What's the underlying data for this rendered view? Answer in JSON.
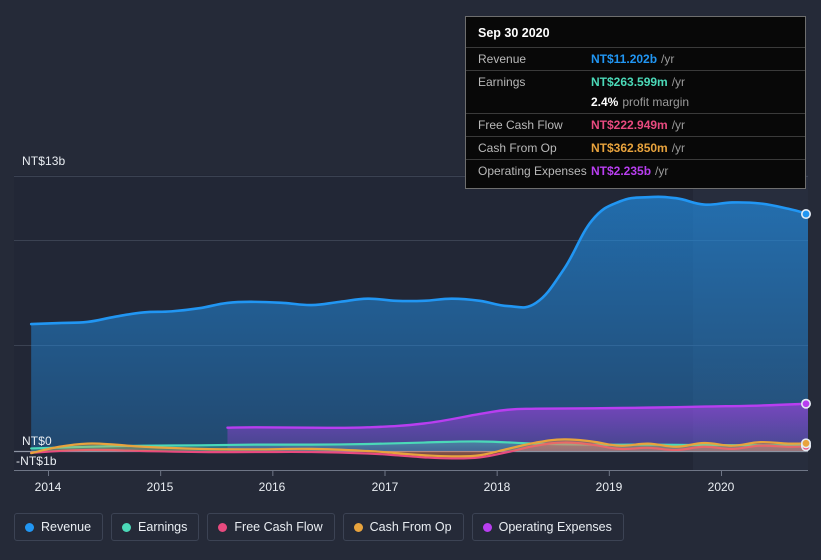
{
  "chart_data": {
    "type": "area",
    "title": "",
    "currency": "NT$",
    "xlabel": "",
    "ylabel": "",
    "ylim": [
      -1,
      13
    ],
    "y_ticks": [
      {
        "label": "NT$13b",
        "value": 13
      },
      {
        "label": "NT$0",
        "value": 0
      },
      {
        "label": "-NT$1b",
        "value": -1
      }
    ],
    "x_ticks": [
      "2014",
      "2015",
      "2016",
      "2017",
      "2018",
      "2019",
      "2020"
    ],
    "x_range": [
      "2013.8",
      "2020.9"
    ],
    "grid": true,
    "legend_position": "bottom-left",
    "series": [
      {
        "name": "Revenue",
        "color": "#2196f3",
        "x": [
          2013.85,
          2014.1,
          2014.35,
          2014.6,
          2014.85,
          2015.1,
          2015.35,
          2015.6,
          2015.85,
          2016.1,
          2016.35,
          2016.6,
          2016.85,
          2017.1,
          2017.35,
          2017.6,
          2017.85,
          2018.1,
          2018.35,
          2018.6,
          2018.85,
          2019.1,
          2019.35,
          2019.6,
          2019.85,
          2020.1,
          2020.35,
          2020.6,
          2020.78
        ],
        "values": [
          6.0,
          6.05,
          6.1,
          6.35,
          6.55,
          6.6,
          6.75,
          7.0,
          7.05,
          7.0,
          6.9,
          7.05,
          7.2,
          7.1,
          7.1,
          7.2,
          7.1,
          6.85,
          7.0,
          8.6,
          10.9,
          11.8,
          12.0,
          11.95,
          11.65,
          11.75,
          11.7,
          11.45,
          11.202
        ]
      },
      {
        "name": "Earnings",
        "color": "#4bd9b8",
        "x": [
          2013.85,
          2014.35,
          2014.85,
          2015.35,
          2015.85,
          2016.35,
          2016.85,
          2017.35,
          2017.85,
          2018.35,
          2018.85,
          2019.35,
          2019.85,
          2020.35,
          2020.78
        ],
        "values": [
          0.12,
          0.2,
          0.25,
          0.27,
          0.3,
          0.3,
          0.33,
          0.4,
          0.45,
          0.35,
          0.3,
          0.3,
          0.28,
          0.27,
          0.263599
        ]
      },
      {
        "name": "Free Cash Flow",
        "color": "#e84a7f",
        "x": [
          2013.85,
          2014.35,
          2014.85,
          2015.35,
          2015.85,
          2016.35,
          2016.85,
          2017.1,
          2017.35,
          2017.6,
          2017.85,
          2018.1,
          2018.35,
          2018.6,
          2018.85,
          2019.1,
          2019.35,
          2019.6,
          2019.85,
          2020.1,
          2020.35,
          2020.6,
          2020.78
        ],
        "values": [
          -0.08,
          0.05,
          0.0,
          -0.05,
          -0.05,
          -0.05,
          -0.12,
          -0.2,
          -0.3,
          -0.35,
          -0.3,
          -0.05,
          0.25,
          0.4,
          0.3,
          0.1,
          0.15,
          0.05,
          0.2,
          0.1,
          0.25,
          0.2,
          0.222949
        ]
      },
      {
        "name": "Cash From Op",
        "color": "#e8a33d",
        "x": [
          2013.85,
          2014.1,
          2014.35,
          2014.6,
          2014.85,
          2015.35,
          2015.85,
          2016.35,
          2016.85,
          2017.1,
          2017.35,
          2017.6,
          2017.85,
          2018.1,
          2018.35,
          2018.6,
          2018.85,
          2019.1,
          2019.35,
          2019.6,
          2019.85,
          2020.1,
          2020.35,
          2020.6,
          2020.78
        ],
        "values": [
          -0.1,
          0.2,
          0.35,
          0.3,
          0.2,
          0.1,
          0.08,
          0.1,
          0.0,
          -0.1,
          -0.2,
          -0.25,
          -0.2,
          0.1,
          0.4,
          0.55,
          0.45,
          0.25,
          0.35,
          0.2,
          0.38,
          0.25,
          0.42,
          0.35,
          0.36285
        ]
      },
      {
        "name": "Operating Expenses",
        "color": "#b83ef0",
        "x": [
          2015.6,
          2015.85,
          2016.35,
          2016.85,
          2017.35,
          2017.85,
          2018.1,
          2018.35,
          2018.85,
          2019.35,
          2019.85,
          2020.35,
          2020.78
        ],
        "values": [
          1.1,
          1.12,
          1.1,
          1.12,
          1.3,
          1.75,
          1.95,
          2.0,
          2.02,
          2.05,
          2.1,
          2.15,
          2.235
        ]
      }
    ]
  },
  "tooltip": {
    "date": "Sep 30 2020",
    "rows": [
      {
        "label": "Revenue",
        "value": "NT$11.202b",
        "unit": "/yr",
        "color": "#2196f3"
      },
      {
        "label": "Earnings",
        "value": "NT$263.599m",
        "unit": "/yr",
        "color": "#4bd9b8"
      },
      {
        "label": "",
        "value": "2.4%",
        "unit": "profit margin",
        "color": "#ffffff"
      },
      {
        "label": "Free Cash Flow",
        "value": "NT$222.949m",
        "unit": "/yr",
        "color": "#e84a7f"
      },
      {
        "label": "Cash From Op",
        "value": "NT$362.850m",
        "unit": "/yr",
        "color": "#e8a33d"
      },
      {
        "label": "Operating Expenses",
        "value": "NT$2.235b",
        "unit": "/yr",
        "color": "#b83ef0"
      }
    ]
  },
  "legend": {
    "items": [
      {
        "label": "Revenue",
        "color": "#2196f3"
      },
      {
        "label": "Earnings",
        "color": "#4bd9b8"
      },
      {
        "label": "Free Cash Flow",
        "color": "#e84a7f"
      },
      {
        "label": "Cash From Op",
        "color": "#e8a33d"
      },
      {
        "label": "Operating Expenses",
        "color": "#b83ef0"
      }
    ]
  },
  "axis": {
    "y_labels": [
      "NT$13b",
      "NT$0",
      "-NT$1b"
    ],
    "x_labels": [
      "2014",
      "2015",
      "2016",
      "2017",
      "2018",
      "2019",
      "2020"
    ]
  }
}
